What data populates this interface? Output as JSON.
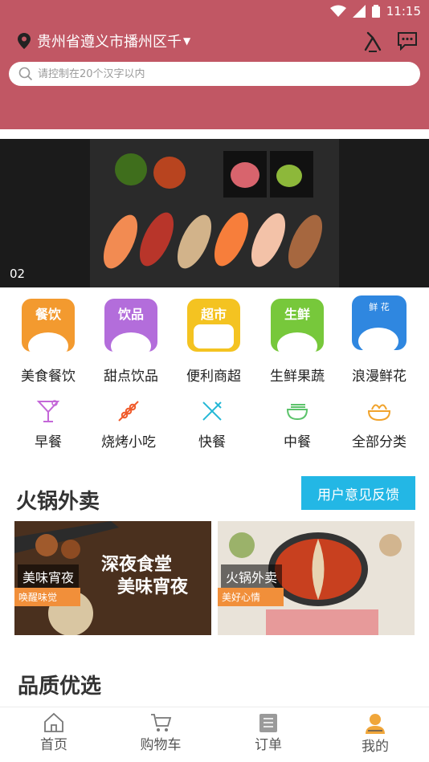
{
  "status": {
    "time": "11:15"
  },
  "header": {
    "location": "贵州省遵义市播州区千",
    "search_placeholder": "请控制在20个汉字以内"
  },
  "banner": {
    "index": "02"
  },
  "categories": [
    {
      "tile_title": "餐饮",
      "label": "美食餐饮",
      "color": "#f39a2f"
    },
    {
      "tile_title": "饮品",
      "label": "甜点饮品",
      "color": "#b36ddb"
    },
    {
      "tile_title": "超市",
      "label": "便利商超",
      "color": "#f4c321"
    },
    {
      "tile_title": "生鲜",
      "label": "生鲜果蔬",
      "color": "#77c83b"
    },
    {
      "tile_title": "鲜 花",
      "label": "浪漫鲜花",
      "color": "#2f87e0"
    }
  ],
  "subcategories": [
    {
      "label": "早餐",
      "icon": "cocktail-icon",
      "color": "#c467d8"
    },
    {
      "label": "烧烤小吃",
      "icon": "skewer-icon",
      "color": "#f05a2a"
    },
    {
      "label": "快餐",
      "icon": "fork-knife-icon",
      "color": "#25b8d6"
    },
    {
      "label": "中餐",
      "icon": "bowl-icon",
      "color": "#5cc36b"
    },
    {
      "label": "全部分类",
      "icon": "noodle-bowl-icon",
      "color": "#f1a32c"
    }
  ],
  "section": {
    "title": "火锅外卖",
    "feedback_label": "用户意见反馈"
  },
  "promos": [
    {
      "title": "美味宵夜",
      "tag": "唤醒味觉",
      "banner_text_1": "深夜食堂",
      "banner_text_2": "美味宵夜"
    },
    {
      "title": "火锅外卖",
      "tag": "美好心情"
    }
  ],
  "section2": {
    "title": "品质优选"
  },
  "tabbar": [
    {
      "label": "首页",
      "icon": "home-icon"
    },
    {
      "label": "购物车",
      "icon": "cart-icon"
    },
    {
      "label": "订单",
      "icon": "order-icon"
    },
    {
      "label": "我的",
      "icon": "user-icon",
      "active_color": "#f0a63a"
    }
  ],
  "colors": {
    "header": "#c15764",
    "accent": "#23b7e5",
    "tag": "#f18f3a"
  }
}
